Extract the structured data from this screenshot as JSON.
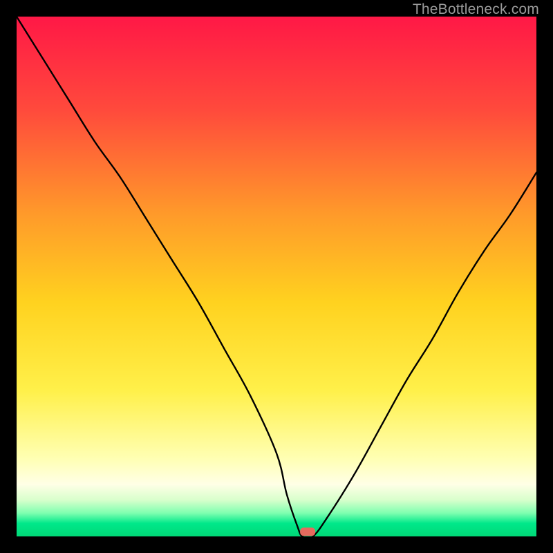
{
  "watermark": "TheBottleneck.com",
  "colors": {
    "bg_black": "#000000",
    "grad_top": "#ff1744",
    "grad_mid1": "#ff5533",
    "grad_mid2": "#ffb300",
    "grad_mid3": "#ffe066",
    "grad_pale": "#ffffcc",
    "grad_green": "#00e676",
    "curve": "#000000",
    "marker": "#e56a5e"
  },
  "chart_data": {
    "type": "line",
    "title": "",
    "xlabel": "",
    "ylabel": "",
    "xlim": [
      0,
      100
    ],
    "ylim": [
      0,
      100
    ],
    "series": [
      {
        "name": "bottleneck-curve",
        "x": [
          0,
          5,
          10,
          15,
          20,
          25,
          30,
          35,
          40,
          45,
          50,
          52,
          54,
          55,
          57,
          60,
          65,
          70,
          75,
          80,
          85,
          90,
          95,
          100
        ],
        "y": [
          100,
          92,
          84,
          76,
          69,
          61,
          53,
          45,
          36,
          27,
          16,
          8,
          2,
          0,
          0,
          4,
          12,
          21,
          30,
          38,
          47,
          55,
          62,
          70
        ]
      }
    ],
    "marker": {
      "x": 56,
      "y": 0.5,
      "name": "optimal-point"
    },
    "gradient_stops": [
      {
        "offset": 0.0,
        "color": "#ff1846"
      },
      {
        "offset": 0.18,
        "color": "#ff4a3c"
      },
      {
        "offset": 0.38,
        "color": "#ff9a2a"
      },
      {
        "offset": 0.55,
        "color": "#ffd21f"
      },
      {
        "offset": 0.72,
        "color": "#fff04a"
      },
      {
        "offset": 0.85,
        "color": "#ffffb3"
      },
      {
        "offset": 0.9,
        "color": "#ffffe6"
      },
      {
        "offset": 0.93,
        "color": "#d8ffcc"
      },
      {
        "offset": 0.955,
        "color": "#7fffb0"
      },
      {
        "offset": 0.975,
        "color": "#00e88a"
      },
      {
        "offset": 1.0,
        "color": "#00d977"
      }
    ]
  }
}
